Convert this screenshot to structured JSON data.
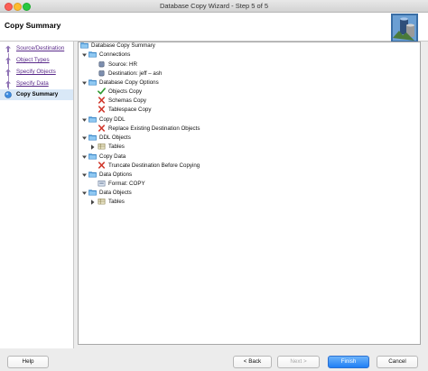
{
  "window": {
    "title": "Database Copy Wizard - Step 5 of 5"
  },
  "header": {
    "step_title": "Copy Summary"
  },
  "sidebar": {
    "steps": [
      {
        "label": "Source/Destination"
      },
      {
        "label": "Object Types"
      },
      {
        "label": "Specify Objects"
      },
      {
        "label": "Specify Data"
      },
      {
        "label": "Copy Summary"
      }
    ]
  },
  "tree": {
    "root": "Database Copy Summary",
    "connections": {
      "label": "Connections",
      "source": "Source: HR",
      "destination": "Destination: jeff – ash"
    },
    "copy_options": {
      "label": "Database Copy Options",
      "objects": "Objects Copy",
      "schemas": "Schemas Copy",
      "tablespace": "Tablespace Copy"
    },
    "copy_ddl": {
      "label": "Copy DDL",
      "replace": "Replace Existing Destination Objects"
    },
    "ddl_objects": {
      "label": "DDL Objects",
      "tables": "Tables"
    },
    "copy_data": {
      "label": "Copy Data",
      "truncate": "Truncate Destination Before Copying"
    },
    "data_options": {
      "label": "Data Options",
      "format": "Format: COPY"
    },
    "data_objects": {
      "label": "Data Objects",
      "tables": "Tables"
    }
  },
  "footer": {
    "help": "Help",
    "back": "< Back",
    "next": "Next >",
    "finish": "Finish",
    "cancel": "Cancel"
  },
  "colors": {
    "folder": "#5aa8e6",
    "check": "#2f9a2f",
    "cross": "#d0362a",
    "accent": "#1f7ff5"
  }
}
